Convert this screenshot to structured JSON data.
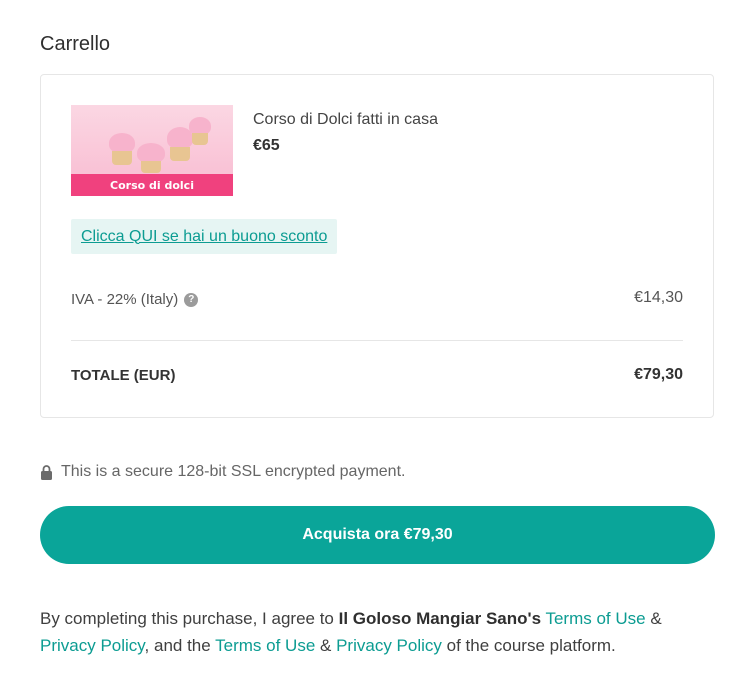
{
  "header": {
    "title": "Carrello"
  },
  "cart": {
    "item": {
      "name": "Corso di Dolci fatti in casa",
      "price": "€65",
      "thumbnail_caption": "Corso di dolci"
    },
    "coupon_link": "Clicca QUI se hai un buono sconto",
    "tax": {
      "label": "IVA - 22% (Italy)",
      "value": "€14,30"
    },
    "total": {
      "label": "TOTALE (EUR)",
      "value": "€79,30"
    }
  },
  "security": {
    "text": "This is a secure 128-bit SSL encrypted payment."
  },
  "buy_button": {
    "label": "Acquista ora €79,30"
  },
  "terms": {
    "prefix": "By completing this purchase, I agree to",
    "brand": "Il Goloso Mangiar Sano's",
    "terms_link_1": "Terms of Use",
    "amp_1": "&",
    "privacy_link_1": "Privacy Policy",
    "middle": ", and the",
    "terms_link_2": "Terms of Use",
    "amp_2": "&",
    "privacy_link_2": "Privacy Policy",
    "suffix": "of the course platform."
  },
  "colors": {
    "accent": "#0aa599",
    "link": "#0c9c92",
    "coupon_bg": "#e6f5f3"
  },
  "icons": {
    "help": "question-circle-icon",
    "lock": "lock-icon"
  }
}
